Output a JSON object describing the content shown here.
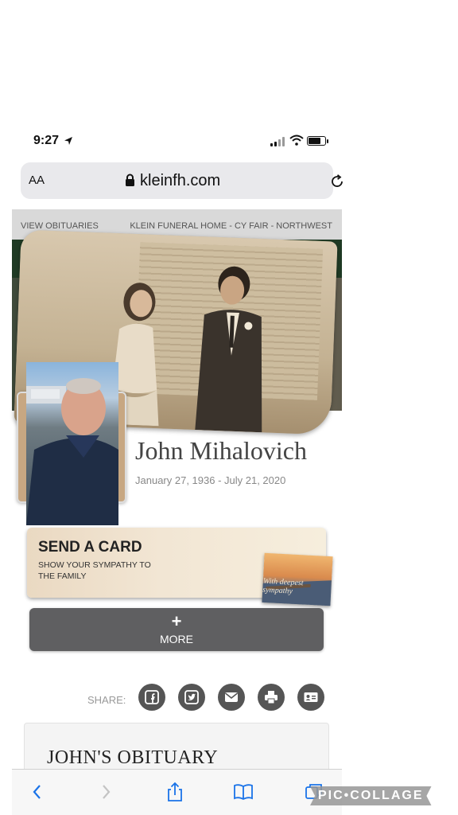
{
  "status_bar": {
    "time": "9:27"
  },
  "browser": {
    "aa_label": "AA",
    "url": "kleinfh.com"
  },
  "site_nav": {
    "left_link": "VIEW OBITUARIES",
    "right_link": "KLEIN FUNERAL HOME - CY FAIR - NORTHWEST"
  },
  "obituary": {
    "name": "John Mihalovich",
    "dates": "January 27, 1936 - July 21, 2020",
    "section_title": "JOHN'S OBITUARY"
  },
  "send_card": {
    "title": "SEND A CARD",
    "subtitle": "SHOW YOUR SYMPATHY TO THE FAMILY",
    "thumb_text": "With deepest sympathy"
  },
  "more_button": {
    "icon": "+",
    "label": "MORE"
  },
  "share": {
    "label": "SHARE:",
    "buttons": [
      {
        "name": "facebook-icon"
      },
      {
        "name": "twitter-icon"
      },
      {
        "name": "email-icon"
      },
      {
        "name": "print-icon"
      },
      {
        "name": "contact-card-icon"
      }
    ]
  },
  "watermark": "PIC•COLLAGE",
  "colors": {
    "nav_bg": "#d9d9d9",
    "more_bg": "#5f5f61",
    "share_btn": "#555555",
    "name_text": "#444444",
    "ios_blue": "#1a73e8"
  }
}
